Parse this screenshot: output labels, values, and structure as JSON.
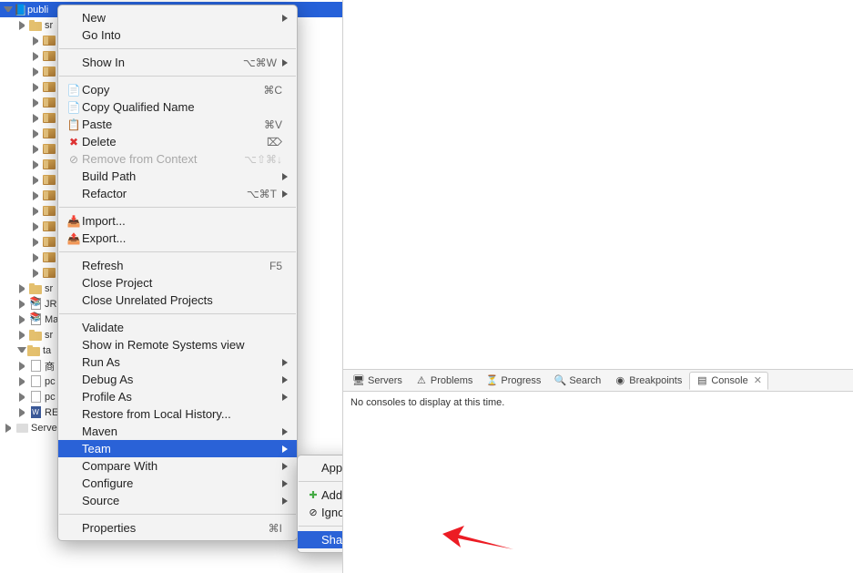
{
  "tree": {
    "root": "publi",
    "items": [
      {
        "indent": 2,
        "type": "folder",
        "label": "sr"
      },
      {
        "indent": 3,
        "type": "pkg",
        "label": ""
      },
      {
        "indent": 3,
        "type": "pkg",
        "label": ""
      },
      {
        "indent": 3,
        "type": "pkg",
        "label": ""
      },
      {
        "indent": 3,
        "type": "pkg",
        "label": ""
      },
      {
        "indent": 3,
        "type": "pkg",
        "label": ""
      },
      {
        "indent": 3,
        "type": "pkg",
        "label": ""
      },
      {
        "indent": 3,
        "type": "pkg",
        "label": ""
      },
      {
        "indent": 3,
        "type": "pkg",
        "label": ""
      },
      {
        "indent": 3,
        "type": "pkg",
        "label": ""
      },
      {
        "indent": 3,
        "type": "pkg",
        "label": ""
      },
      {
        "indent": 3,
        "type": "pkg",
        "label": ""
      },
      {
        "indent": 3,
        "type": "pkg",
        "label": ""
      },
      {
        "indent": 3,
        "type": "pkg",
        "label": ""
      },
      {
        "indent": 3,
        "type": "pkg",
        "label": ""
      },
      {
        "indent": 3,
        "type": "pkg",
        "label": ""
      },
      {
        "indent": 3,
        "type": "pkg",
        "label": ""
      },
      {
        "indent": 2,
        "type": "folder",
        "label": "sr"
      },
      {
        "indent": 2,
        "type": "jar",
        "label": "JR"
      },
      {
        "indent": 2,
        "type": "jar",
        "label": "Ma"
      },
      {
        "indent": 2,
        "type": "folder",
        "label": "sr"
      },
      {
        "indent": 2,
        "type": "folder-open",
        "label": "ta"
      },
      {
        "indent": 2,
        "type": "file",
        "label": "商"
      },
      {
        "indent": 2,
        "type": "xml",
        "label": "pc"
      },
      {
        "indent": 2,
        "type": "xml",
        "label": "pc"
      },
      {
        "indent": 2,
        "type": "word",
        "label": "RE"
      },
      {
        "indent": 1,
        "type": "srv",
        "label": "Serve"
      }
    ]
  },
  "menu": {
    "items": [
      {
        "label": "New",
        "arrow": true
      },
      {
        "label": "Go Into"
      },
      {
        "sep": true
      },
      {
        "label": "Show In",
        "shortcut": "⌥⌘W",
        "arrow": true
      },
      {
        "sep": true
      },
      {
        "icon": "copy",
        "label": "Copy",
        "shortcut": "⌘C"
      },
      {
        "icon": "copy",
        "label": "Copy Qualified Name"
      },
      {
        "icon": "paste",
        "label": "Paste",
        "shortcut": "⌘V"
      },
      {
        "icon": "delete",
        "label": "Delete",
        "shortcut": "⌦"
      },
      {
        "icon": "remove",
        "label": "Remove from Context",
        "shortcut": "⌥⇧⌘↓",
        "disabled": true
      },
      {
        "label": "Build Path",
        "arrow": true
      },
      {
        "label": "Refactor",
        "shortcut": "⌥⌘T",
        "arrow": true
      },
      {
        "sep": true
      },
      {
        "icon": "import",
        "label": "Import..."
      },
      {
        "icon": "export",
        "label": "Export..."
      },
      {
        "sep": true
      },
      {
        "label": "Refresh",
        "shortcut": "F5"
      },
      {
        "label": "Close Project"
      },
      {
        "label": "Close Unrelated Projects"
      },
      {
        "sep": true
      },
      {
        "label": "Validate"
      },
      {
        "label": "Show in Remote Systems view"
      },
      {
        "label": "Run As",
        "arrow": true
      },
      {
        "label": "Debug As",
        "arrow": true
      },
      {
        "label": "Profile As",
        "arrow": true
      },
      {
        "label": "Restore from Local History..."
      },
      {
        "label": "Maven",
        "arrow": true
      },
      {
        "label": "Team",
        "arrow": true,
        "highlight": true
      },
      {
        "label": "Compare With",
        "arrow": true
      },
      {
        "label": "Configure",
        "arrow": true
      },
      {
        "label": "Source",
        "arrow": true
      },
      {
        "sep": true
      },
      {
        "label": "Properties",
        "shortcut": "⌘I"
      }
    ]
  },
  "submenu": {
    "items": [
      {
        "label": "Apply Patch..."
      },
      {
        "sep": true
      },
      {
        "icon": "add",
        "label": "Add to Index"
      },
      {
        "icon": "ignore",
        "label": "Ignore"
      },
      {
        "sep": true
      },
      {
        "label": "Share Project...",
        "highlight": true
      }
    ]
  },
  "tabs": {
    "servers": "Servers",
    "problems": "Problems",
    "progress": "Progress",
    "search": "Search",
    "breakpoints": "Breakpoints",
    "console": "Console"
  },
  "console_msg": "No consoles to display at this time."
}
